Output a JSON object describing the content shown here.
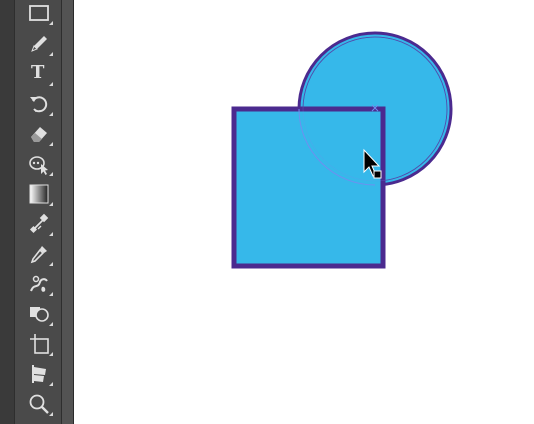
{
  "toolbar": {
    "tools": [
      {
        "name": "rectangle-tool",
        "icon": "rectangle-icon"
      },
      {
        "name": "pencil-tool",
        "icon": "pencil-icon"
      },
      {
        "name": "type-tool",
        "icon": "type-icon",
        "label": "T"
      },
      {
        "name": "rotate-tool",
        "icon": "rotate-icon"
      },
      {
        "name": "eraser-tool",
        "icon": "eraser-icon"
      },
      {
        "name": "puppet-warp-tool",
        "icon": "puppet-warp-icon"
      },
      {
        "name": "gradient-tool",
        "icon": "gradient-icon"
      },
      {
        "name": "blend-tool",
        "icon": "blend-icon"
      },
      {
        "name": "eyedropper-tool",
        "icon": "eyedropper-icon"
      },
      {
        "name": "symbol-sprayer-tool",
        "icon": "symbol-sprayer-icon"
      },
      {
        "name": "shape-builder-tool",
        "icon": "shape-builder-icon"
      },
      {
        "name": "artboard-tool",
        "icon": "artboard-icon"
      },
      {
        "name": "slice-tool",
        "icon": "slice-icon"
      },
      {
        "name": "zoom-tool",
        "icon": "zoom-icon"
      }
    ]
  },
  "colors": {
    "shape_fill": "#36b8ea",
    "shape_stroke": "#4b2a8f",
    "selection_guide": "#6f8ff0",
    "toolbar_bg": "#4a4a4a",
    "icon": "#e0e0e0"
  },
  "canvas": {
    "cursor": "selection-arrow-icon"
  }
}
